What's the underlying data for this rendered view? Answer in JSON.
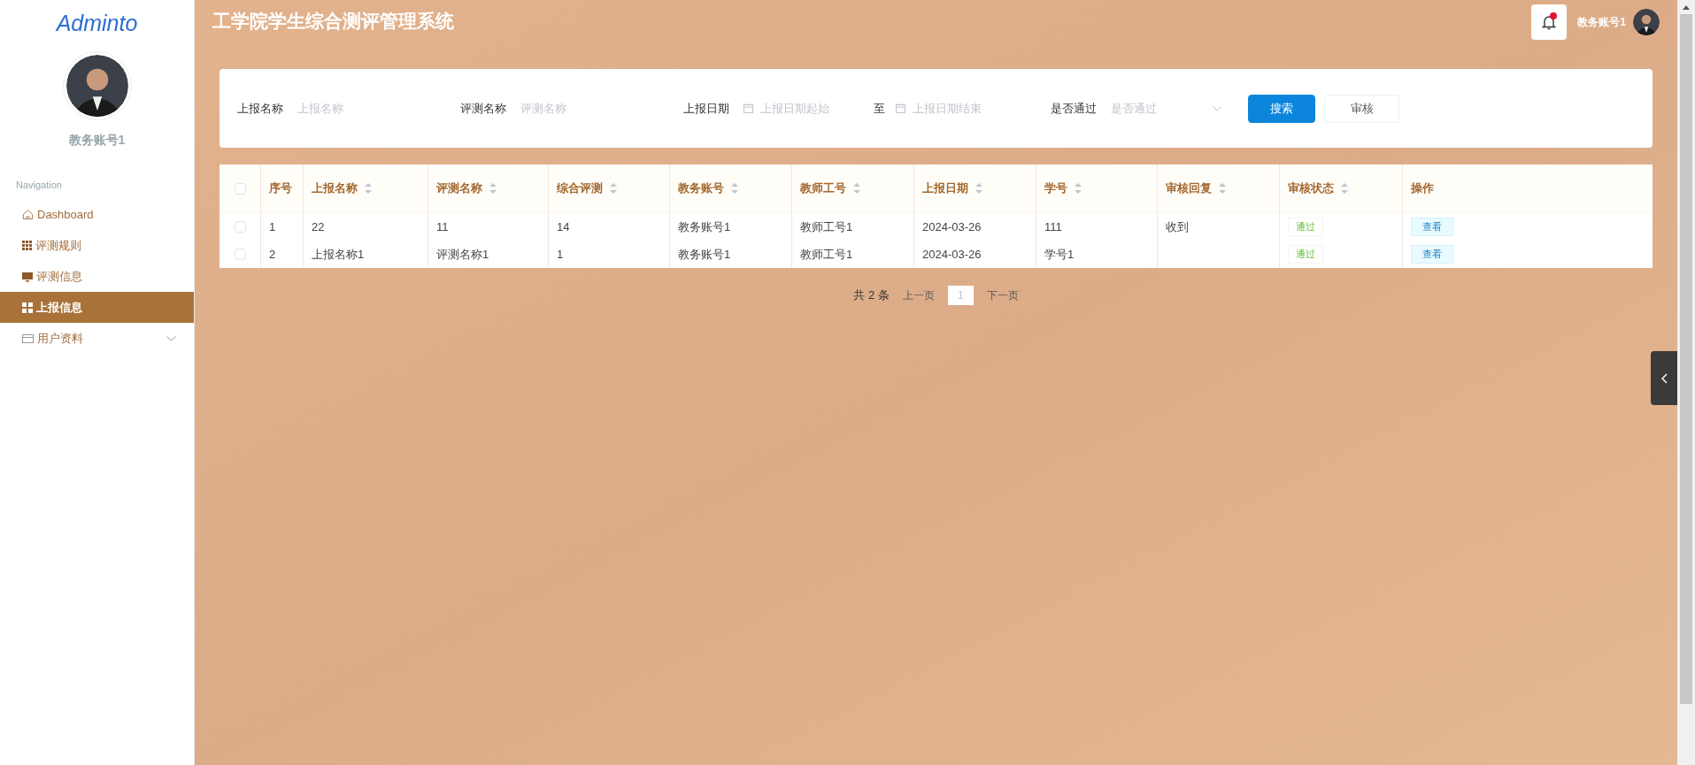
{
  "sidebar": {
    "logo": "Adminto",
    "user": "教务账号1",
    "nav_heading": "Navigation",
    "items": [
      {
        "label": "Dashboard",
        "selected": false,
        "expandable": false
      },
      {
        "label": "评测规则",
        "selected": false,
        "expandable": false
      },
      {
        "label": "评测信息",
        "selected": false,
        "expandable": false
      },
      {
        "label": "上报信息",
        "selected": true,
        "expandable": false
      },
      {
        "label": "用户资料",
        "selected": false,
        "expandable": true
      }
    ]
  },
  "header": {
    "title": "工学院学生综合测评管理系统",
    "user": "教务账号1",
    "notification_dot": true
  },
  "filters": [
    {
      "kind": "text",
      "label": "上报名称",
      "placeholder": "上报名称"
    },
    {
      "kind": "text",
      "label": "评测名称",
      "placeholder": "评测名称"
    },
    {
      "kind": "daterange",
      "label": "上报日期",
      "start_placeholder": "上报日期起始",
      "separator": "至",
      "end_placeholder": "上报日期结束"
    },
    {
      "kind": "select",
      "label": "是否通过",
      "placeholder": "是否通过"
    }
  ],
  "filter_buttons": [
    {
      "kind": "primary",
      "label": "搜索"
    },
    {
      "kind": "plain",
      "label": "审核"
    }
  ],
  "table": {
    "select_all": {
      "checked": false
    },
    "columns": [
      {
        "label": "序号",
        "sortable": false
      },
      {
        "label": "上报名称",
        "sortable": true
      },
      {
        "label": "评测名称",
        "sortable": true
      },
      {
        "label": "综合评测",
        "sortable": true
      },
      {
        "label": "教务账号",
        "sortable": true
      },
      {
        "label": "教师工号",
        "sortable": true
      },
      {
        "label": "上报日期",
        "sortable": true
      },
      {
        "label": "学号",
        "sortable": true
      },
      {
        "label": "审核回复",
        "sortable": true
      },
      {
        "label": "审核状态",
        "sortable": true
      },
      {
        "label": "操作",
        "sortable": false
      }
    ],
    "rows": [
      {
        "checked": false,
        "cells": [
          "1",
          "22",
          "11",
          "14",
          "教务账号1",
          "教师工号1",
          "2024-03-26",
          "111",
          "收到"
        ],
        "status": "通过",
        "action": "查看"
      },
      {
        "checked": false,
        "cells": [
          "2",
          "上报名称1",
          "评测名称1",
          "1",
          "教务账号1",
          "教师工号1",
          "2024-03-26",
          "学号1",
          ""
        ],
        "status": "通过",
        "action": "查看"
      }
    ]
  },
  "pagination": {
    "total": "共 2 条",
    "prev": "上一页",
    "pages": [
      {
        "label": "1",
        "selected": true
      }
    ],
    "next": "下一页"
  }
}
